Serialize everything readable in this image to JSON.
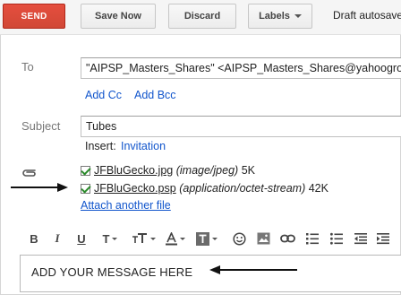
{
  "toolbar": {
    "send_label": "SEND",
    "save_label": "Save Now",
    "discard_label": "Discard",
    "labels_label": "Labels",
    "draft_status": "Draft autosaved"
  },
  "compose": {
    "to_label": "To",
    "to_value": "\"AIPSP_Masters_Shares\" <AIPSP_Masters_Shares@yahoogroups.com>",
    "add_cc": "Add Cc",
    "add_bcc": "Add Bcc",
    "subject_label": "Subject",
    "subject_value": "Tubes",
    "insert_label": "Insert:",
    "insert_link": "Invitation"
  },
  "attachments": [
    {
      "name": "JFBluGecko.jpg",
      "type": "(image/jpeg)",
      "size": "5K",
      "checked": true
    },
    {
      "name": "JFBluGecko.psp",
      "type": "(application/octet-stream)",
      "size": "42K",
      "checked": true
    }
  ],
  "attach_another": "Attach another file",
  "formatting": {
    "bold": "B",
    "italic": "I",
    "underline": "U",
    "font_size": "T"
  },
  "editor": {
    "body_text": "ADD YOUR MESSAGE HERE"
  },
  "colors": {
    "send_bg": "#d14836",
    "link": "#1155cc",
    "checkbox_check": "#2a8a2a"
  }
}
